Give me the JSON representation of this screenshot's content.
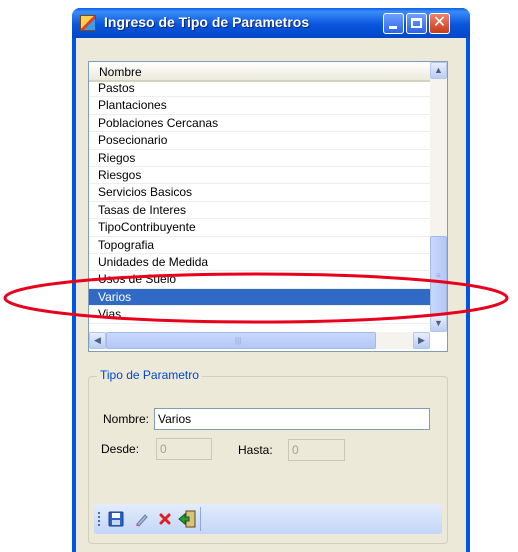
{
  "window": {
    "title": "Ingreso de Tipo de Parametros",
    "controls": [
      "minimize-icon",
      "maximize-icon",
      "close-icon"
    ]
  },
  "grid": {
    "header": "Nombre",
    "rows": [
      "Pastos",
      "Plantaciones",
      "Poblaciones Cercanas",
      "Posecionario",
      "Riegos",
      "Riesgos",
      "Servicios Basicos",
      "Tasas de Interes",
      "TipoContribuyente",
      "Topografia",
      "Unidades de Medida",
      "Usos de Suelo",
      "Varios",
      "Vias"
    ],
    "selected_row": "Varios"
  },
  "group": {
    "legend": "Tipo de Parametro",
    "nombre_label": "Nombre:",
    "nombre_value": "Varios",
    "desde_label": "Desde:",
    "desde_value": "0",
    "hasta_label": "Hasta:",
    "hasta_value": "0"
  },
  "toolbar": {
    "icons": [
      "save-icon",
      "edit-icon",
      "delete-icon",
      "exit-icon"
    ]
  },
  "colors": {
    "titlebar": "#0054e3",
    "selection": "#316ac5",
    "annotation": "#e8001c"
  }
}
